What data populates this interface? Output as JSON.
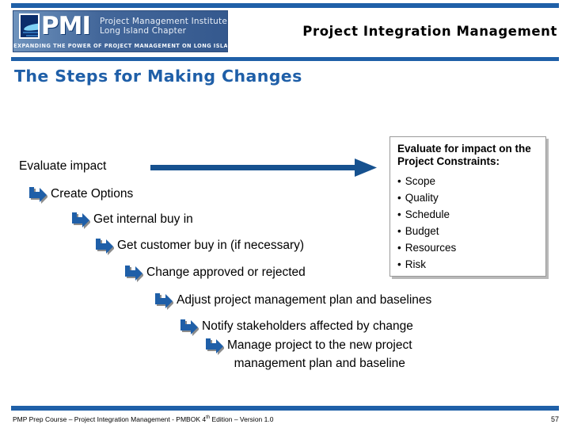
{
  "slide": {
    "header_title": "Project Integration Management",
    "slide_title": "The Steps for Making Changes",
    "accent_color": "#1f60a8",
    "title_color": "#1f5fa8",
    "arrow_color": "#16518f"
  },
  "logo": {
    "acronym": "PMI",
    "line1": "Project Management Institute",
    "line2": "Long Island Chapter",
    "tagline": "EXPANDING THE POWER OF PROJECT MANAGEMENT ON LONG ISLAND"
  },
  "steps": [
    {
      "text": "Evaluate impact",
      "has_arrow": false
    },
    {
      "text": "Create Options",
      "has_arrow": true
    },
    {
      "text": "Get internal buy in",
      "has_arrow": true
    },
    {
      "text": "Get customer buy in (if necessary)",
      "has_arrow": true
    },
    {
      "text": "Change approved or rejected",
      "has_arrow": true
    },
    {
      "text": "Adjust project management plan and baselines",
      "has_arrow": true
    },
    {
      "text": "Notify stakeholders affected by change",
      "has_arrow": true
    },
    {
      "text": "Manage project to the new project",
      "has_arrow": true,
      "text_line2": "management plan and baseline"
    }
  ],
  "constraints": {
    "title": "Evaluate for impact on the Project Constraints:",
    "items": [
      "Scope",
      "Quality",
      "Schedule",
      "Budget",
      "Resources",
      "Risk"
    ]
  },
  "footer": {
    "text_before": "PMP Prep Course – Project Integration Management - PMBOK 4",
    "superscript": "th",
    "text_after": " Edition – Version 1.0",
    "page_number": "57"
  }
}
